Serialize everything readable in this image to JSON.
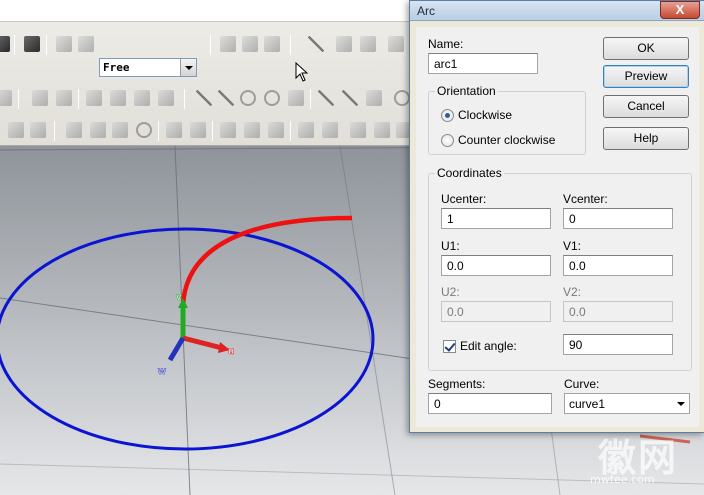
{
  "app": {
    "view_mode_value": "Free",
    "viewport": {
      "axis_labels": {
        "v": "v",
        "u": "u",
        "w": "w"
      },
      "colors": {
        "circle": "#0a14d2",
        "arc": "#ee1111",
        "v_axis": "#22aa22",
        "u_axis": "#dd2222",
        "w_axis": "#2233bb"
      }
    }
  },
  "dialog": {
    "title": "Arc",
    "close_label": "X",
    "name_label": "Name:",
    "name_value": "arc1",
    "orientation": {
      "title": "Orientation",
      "options": [
        {
          "label": "Clockwise",
          "selected": true
        },
        {
          "label": "Counter clockwise",
          "selected": false
        }
      ]
    },
    "coordinates": {
      "title": "Coordinates",
      "ucenter_label": "Ucenter:",
      "ucenter_value": "1",
      "vcenter_label": "Vcenter:",
      "vcenter_value": "0",
      "u1_label": "U1:",
      "u1_value": "0.0",
      "v1_label": "V1:",
      "v1_value": "0.0",
      "u2_label": "U2:",
      "u2_value": "0.0",
      "v2_label": "V2:",
      "v2_value": "0.0",
      "edit_angle_label": "Edit angle:",
      "edit_angle_checked": true,
      "angle_value": "90"
    },
    "segments_label": "Segments:",
    "segments_value": "0",
    "curve_label": "Curve:",
    "curve_value": "curve1",
    "buttons": {
      "ok": "OK",
      "preview": "Preview",
      "cancel": "Cancel",
      "help": "Help"
    }
  }
}
